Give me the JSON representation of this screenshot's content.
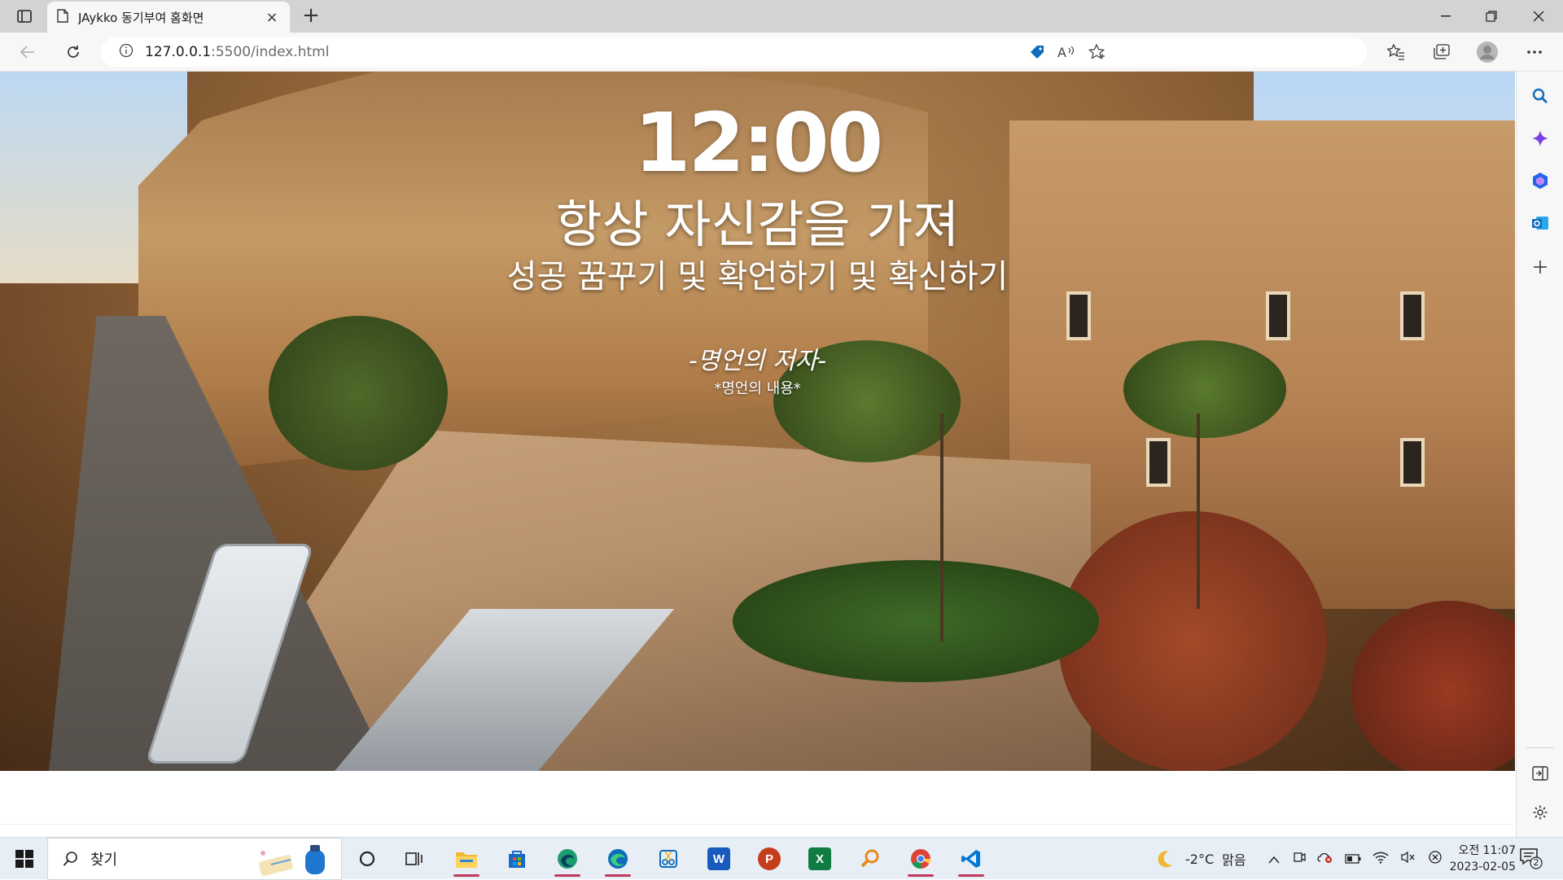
{
  "browser": {
    "tab_title": "JAykko 동기부여 홈화면",
    "new_tab_symbol": "+",
    "close_tab_symbol": "×",
    "url_host": "127.0.0.1",
    "url_rest": ":5500/index.html"
  },
  "page": {
    "clock": "12:00",
    "greeting": "항상 자신감을 가져",
    "goal": "성공 꿈꾸기 및 확언하기 및 확신하기",
    "quote_author": "-명언의 저자-",
    "quote_text": "*명언의 내용*"
  },
  "taskbar": {
    "search_label": "찾기",
    "weather_temp": "-2°C",
    "weather_desc": "맑음",
    "time": "오전 11:07",
    "date": "2023-02-05",
    "notification_count": "2",
    "apps": [
      "file-explorer",
      "microsoft-store",
      "edge-dev",
      "edge",
      "snipping-tool",
      "word",
      "powerpoint",
      "excel",
      "search-app",
      "chrome",
      "vscode"
    ]
  },
  "colors": {
    "accent_underline": "#c0395a",
    "edge_blue": "#0f6cbd",
    "word_blue": "#185abd",
    "powerpoint_red": "#c43e1c",
    "excel_green": "#107c41",
    "vscode_blue": "#0078d4"
  }
}
